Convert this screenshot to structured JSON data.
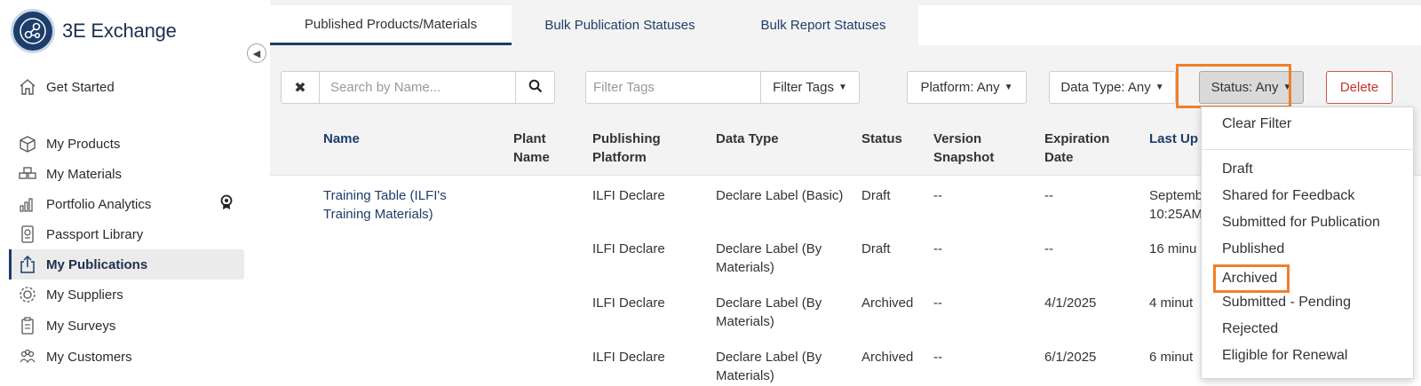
{
  "app": {
    "name": "3E Exchange"
  },
  "sidebar": {
    "items": [
      {
        "label": "Get Started",
        "icon": "home-icon"
      },
      {
        "label": "My Products",
        "icon": "box-icon"
      },
      {
        "label": "My Materials",
        "icon": "materials-icon"
      },
      {
        "label": "Portfolio Analytics",
        "icon": "bar-chart-icon"
      },
      {
        "label": "Passport Library",
        "icon": "passport-icon"
      },
      {
        "label": "My Publications",
        "icon": "share-icon",
        "active": true
      },
      {
        "label": "My Suppliers",
        "icon": "gear-people-icon"
      },
      {
        "label": "My Surveys",
        "icon": "clipboard-icon"
      },
      {
        "label": "My Customers",
        "icon": "people-icon"
      }
    ]
  },
  "tabs": [
    {
      "label": "Published Products/Materials",
      "active": true
    },
    {
      "label": "Bulk Publication Statuses"
    },
    {
      "label": "Bulk Report Statuses"
    }
  ],
  "toolbar": {
    "search_placeholder": "Search by Name...",
    "filter_tags_placeholder": "Filter Tags",
    "filter_tags_label": "Filter Tags",
    "platform_label": "Platform: Any",
    "data_type_label": "Data Type: Any",
    "status_label": "Status: Any",
    "delete_label": "Delete"
  },
  "table": {
    "headers": {
      "name": "Name",
      "plant_name_1": "Plant",
      "plant_name_2": "Name",
      "platform_1": "Publishing",
      "platform_2": "Platform",
      "data_type": "Data Type",
      "status": "Status",
      "version_1": "Version",
      "version_2": "Snapshot",
      "expiration_1": "Expiration",
      "expiration_2": "Date",
      "last_updated": "Last Up"
    },
    "rows": [
      {
        "name_1": "Training Table (ILFI's",
        "name_2": "Training Materials)",
        "platform": "ILFI Declare",
        "data_type_1": "Declare Label (Basic)",
        "data_type_2": "",
        "status": "Draft",
        "version": "--",
        "expiration": "--",
        "updated_1": "Septemb",
        "updated_2": "10:25AM"
      },
      {
        "name_1": "",
        "name_2": "",
        "platform": "ILFI Declare",
        "data_type_1": "Declare Label (By",
        "data_type_2": "Materials)",
        "status": "Draft",
        "version": "--",
        "expiration": "--",
        "updated_1": "16 minu",
        "updated_2": ""
      },
      {
        "name_1": "",
        "name_2": "",
        "platform": "ILFI Declare",
        "data_type_1": "Declare Label (By",
        "data_type_2": "Materials)",
        "status": "Archived",
        "version": "--",
        "expiration": "4/1/2025",
        "updated_1": "4 minut",
        "updated_2": ""
      },
      {
        "name_1": "",
        "name_2": "",
        "platform": "ILFI Declare",
        "data_type_1": "Declare Label (By",
        "data_type_2": "Materials)",
        "status": "Archived",
        "version": "--",
        "expiration": "6/1/2025",
        "updated_1": "6 minut",
        "updated_2": ""
      }
    ]
  },
  "status_dropdown": {
    "clear": "Clear Filter",
    "options": [
      "Draft",
      "Shared for Feedback",
      "Submitted for Publication",
      "Published",
      "Archived",
      "Submitted - Pending",
      "Rejected",
      "Eligible for Renewal"
    ],
    "highlighted": "Archived"
  },
  "colors": {
    "brand": "#1d3d6b",
    "highlight": "#f07f2a",
    "delete": "#c0392b"
  }
}
